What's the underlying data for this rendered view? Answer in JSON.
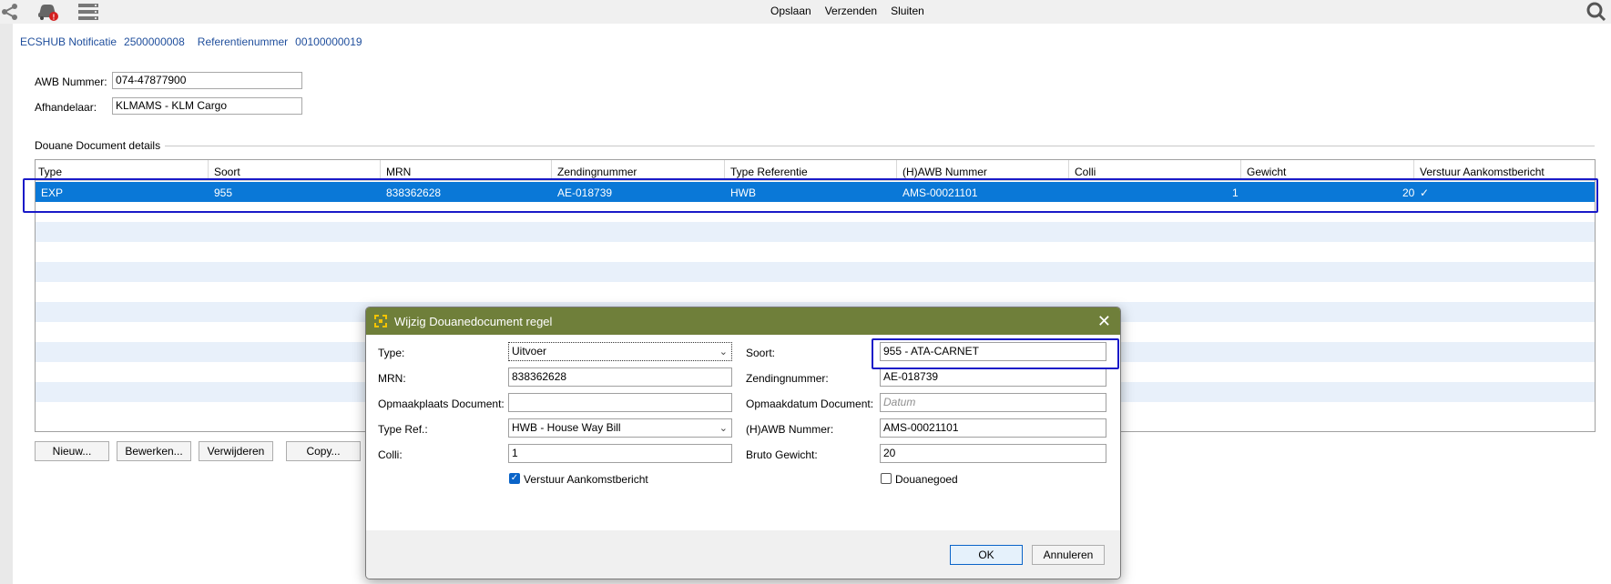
{
  "toolbar": {
    "icons": [
      "share-icon",
      "car-alert-icon",
      "list-icon",
      "search-icon"
    ],
    "menu": [
      "Opslaan",
      "Verzenden",
      "Sluiten"
    ]
  },
  "notification": {
    "ecshub_label": "ECSHUB Notificatie",
    "ecshub_value": "2500000008",
    "ref_label": "Referentienummer",
    "ref_value": "00100000019"
  },
  "form": {
    "awb_label": "AWB Nummer:",
    "awb_value": "074-47877900",
    "afhandelaar_label": "Afhandelaar:",
    "afhandelaar_value": "KLMAMS - KLM Cargo"
  },
  "section": {
    "title": "Douane Document details"
  },
  "grid": {
    "columns": [
      "Type",
      "Soort",
      "MRN",
      "Zendingnummer",
      "Type Referentie",
      "(H)AWB Nummer",
      "Colli",
      "Gewicht",
      "Verstuur Aankomstbericht"
    ],
    "rows": [
      {
        "type": "EXP",
        "soort": "955",
        "mrn": "838362628",
        "zending": "AE-018739",
        "typeref": "HWB",
        "hawb": "AMS-00021101",
        "colli": "1",
        "gewicht": "20",
        "verstuur": "✓"
      }
    ]
  },
  "buttons": {
    "nieuw": "Nieuw...",
    "bewerken": "Bewerken...",
    "verwijderen": "Verwijderen",
    "copy": "Copy..."
  },
  "dialog": {
    "title": "Wijzig Douanedocument regel",
    "type_label": "Type:",
    "type_value": "Uitvoer",
    "soort_label": "Soort:",
    "soort_value": "955 - ATA-CARNET",
    "mrn_label": "MRN:",
    "mrn_value": "838362628",
    "zending_label": "Zendingnummer:",
    "zending_value": "AE-018739",
    "opmaakplaats_label": "Opmaakplaats Document:",
    "opmaakplaats_value": "",
    "opmaakdatum_label": "Opmaakdatum Document:",
    "opmaakdatum_placeholder": "Datum",
    "typeref_label": "Type Ref.:",
    "typeref_value": "HWB - House Way Bill",
    "hawb_label": "(H)AWB Nummer:",
    "hawb_value": "AMS-00021101",
    "colli_label": "Colli:",
    "colli_value": "1",
    "bruto_label": "Bruto Gewicht:",
    "bruto_value": "20",
    "verstuur_label": "Verstuur Aankomstbericht",
    "verstuur_checked": true,
    "douanegoed_label": "Douanegoed",
    "douanegoed_checked": false,
    "ok": "OK",
    "annuleren": "Annuleren"
  }
}
